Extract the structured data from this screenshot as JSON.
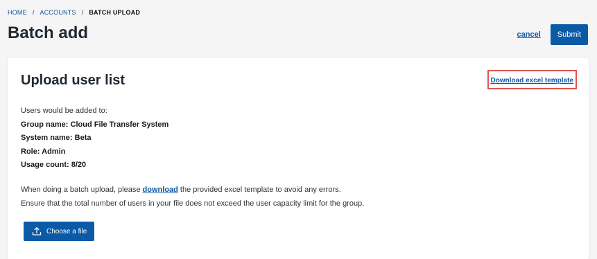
{
  "breadcrumb": {
    "items": [
      "HOME",
      "ACCOUNTS"
    ],
    "separator": "/",
    "current": "BATCH UPLOAD"
  },
  "page": {
    "title": "Batch add"
  },
  "actions": {
    "cancel_label": "cancel",
    "submit_label": "Submit"
  },
  "card": {
    "title": "Upload user list",
    "template_link_label": "Download excel template",
    "intro": "Users would be added to:",
    "details": [
      "Group name: Cloud File Transfer System",
      "System name: Beta",
      "Role: Admin",
      "Usage count: 8/20"
    ],
    "note_prefix": "When doing a batch upload, please ",
    "note_link": "download",
    "note_suffix": " the provided excel template to avoid any errors.",
    "note_capacity": "Ensure that the total number of users in your file does not exceed the user capacity limit for the group.",
    "choose_file_label": "Choose a file",
    "choose_file_icon": "upload-icon"
  },
  "colors": {
    "accent": "#0b5aa6",
    "highlight_border": "#e0544f",
    "background": "#f5f5f5"
  }
}
